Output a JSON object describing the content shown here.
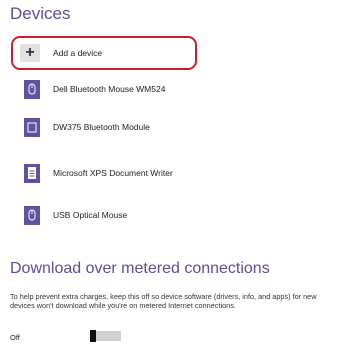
{
  "title": "Devices",
  "add_device": {
    "icon": "plus-icon",
    "label": "Add a device"
  },
  "devices": [
    {
      "icon": "mouse-icon",
      "label": "Dell Bluetooth Mouse WM524"
    },
    {
      "icon": "bluetooth-module-icon",
      "label": "DW375 Bluetooth Module"
    },
    {
      "icon": "printer-document-icon",
      "label": "Microsoft XPS Document Writer"
    },
    {
      "icon": "mouse-icon",
      "label": "USB Optical Mouse"
    }
  ],
  "metered": {
    "title": "Download over metered connections",
    "description": "To help prevent extra charges, keep this off so device software (drivers, info, and apps) for new devices won't download while you're on metered Internet connections.",
    "toggle_label": "Off",
    "toggle_on": false
  },
  "colors": {
    "accent": "#5a4f9a",
    "icon_bg": "#5e52a2",
    "highlight": "#cc1f2d"
  }
}
